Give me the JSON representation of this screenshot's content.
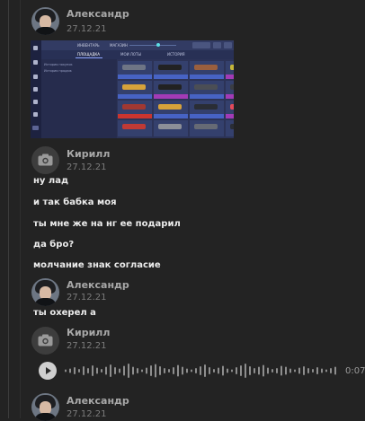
{
  "messages": [
    {
      "author": "Александр",
      "date": "27.12.21"
    },
    {
      "author": "Кирилл",
      "date": "27.12.21",
      "lines": [
        "ну лад",
        "и так бабка моя",
        "ты мне же на нг ее подарил",
        "да бро?",
        "молчание знак согласие"
      ]
    },
    {
      "author": "Александр",
      "date": "27.12.21",
      "lines": [
        "ты охерел а"
      ]
    },
    {
      "author": "Кирилл",
      "date": "27.12.21"
    },
    {
      "author": "Александр",
      "date": "27.12.21"
    }
  ],
  "voice": {
    "duration": "0:07"
  },
  "screenshot": {
    "topbar": {
      "title": "ИНВЕНТАРЬ",
      "section": "МАГАЗИН"
    },
    "tabs": [
      "ПЛОЩАДКА",
      "МОИ ЛОТЫ",
      "ИСТОРИЯ"
    ],
    "left_items": [
      "История покупок",
      "История продаж"
    ]
  },
  "colors": {
    "background": "#232323",
    "name": "#a8a8a8",
    "message": "#ececec",
    "muted": "#7c7c7c"
  },
  "icons": [
    "camera-icon",
    "play-icon"
  ]
}
